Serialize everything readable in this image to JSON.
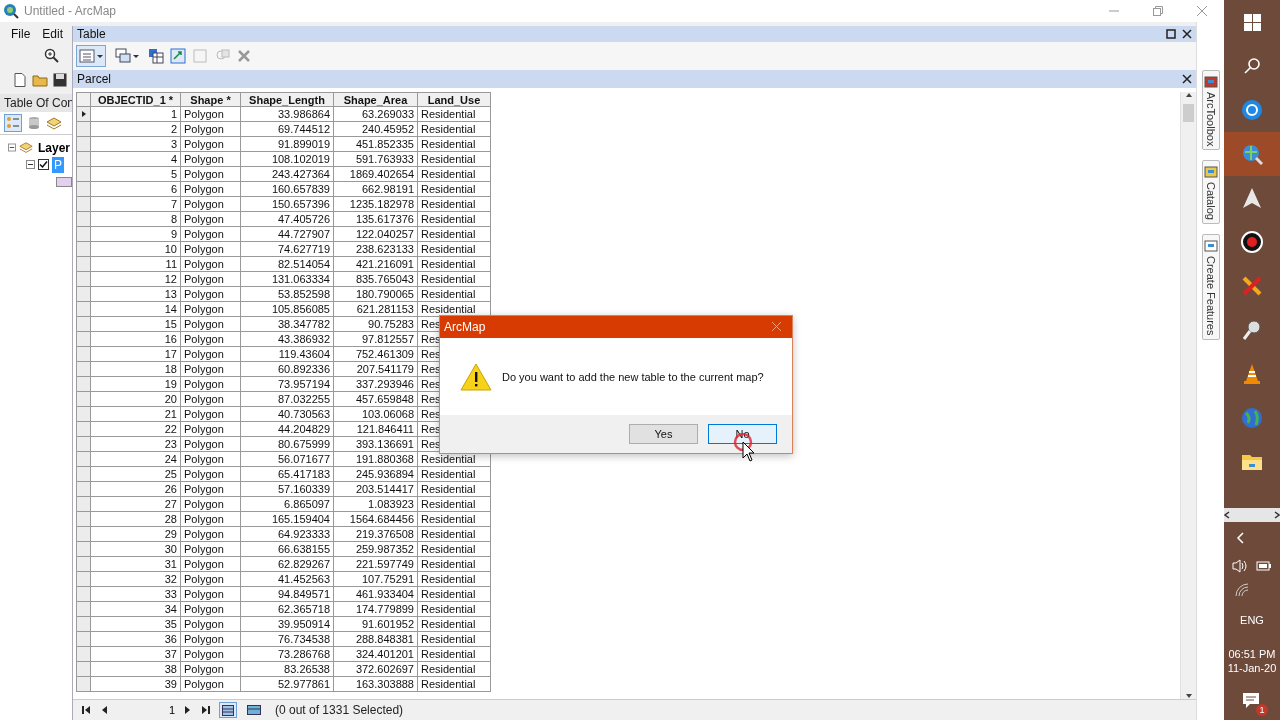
{
  "window": {
    "title": "Untitled - ArcMap"
  },
  "menu": [
    "File",
    "Edit"
  ],
  "toc": {
    "title": "Table Of Con",
    "layers": [
      {
        "label": "Layer",
        "expanded": true,
        "children": [
          {
            "label": "P",
            "expanded": true,
            "checked": true,
            "selected": true
          }
        ]
      }
    ]
  },
  "table_window": {
    "title": "Table",
    "tab": "Parcel",
    "columns": [
      "OBJECTID_1 *",
      "Shape *",
      "Shape_Length",
      "Shape_Area",
      "Land_Use"
    ],
    "rows": [
      {
        "current": true,
        "cells": [
          "1",
          "Polygon",
          "33.986864",
          "63.269033",
          "Residential"
        ]
      },
      {
        "current": false,
        "cells": [
          "2",
          "Polygon",
          "69.744512",
          "240.45952",
          "Residential"
        ]
      },
      {
        "current": false,
        "cells": [
          "3",
          "Polygon",
          "91.899019",
          "451.852335",
          "Residential"
        ]
      },
      {
        "current": false,
        "cells": [
          "4",
          "Polygon",
          "108.102019",
          "591.763933",
          "Residential"
        ]
      },
      {
        "current": false,
        "cells": [
          "5",
          "Polygon",
          "243.427364",
          "1869.402654",
          "Residential"
        ]
      },
      {
        "current": false,
        "cells": [
          "6",
          "Polygon",
          "160.657839",
          "662.98191",
          "Residential"
        ]
      },
      {
        "current": false,
        "cells": [
          "7",
          "Polygon",
          "150.657396",
          "1235.182978",
          "Residential"
        ]
      },
      {
        "current": false,
        "cells": [
          "8",
          "Polygon",
          "47.405726",
          "135.617376",
          "Residential"
        ]
      },
      {
        "current": false,
        "cells": [
          "9",
          "Polygon",
          "44.727907",
          "122.040257",
          "Residential"
        ]
      },
      {
        "current": false,
        "cells": [
          "10",
          "Polygon",
          "74.627719",
          "238.623133",
          "Residential"
        ]
      },
      {
        "current": false,
        "cells": [
          "11",
          "Polygon",
          "82.514054",
          "421.216091",
          "Residential"
        ]
      },
      {
        "current": false,
        "cells": [
          "12",
          "Polygon",
          "131.063334",
          "835.765043",
          "Residential"
        ]
      },
      {
        "current": false,
        "cells": [
          "13",
          "Polygon",
          "53.852598",
          "180.790065",
          "Residential"
        ]
      },
      {
        "current": false,
        "cells": [
          "14",
          "Polygon",
          "105.856085",
          "621.281153",
          "Residential"
        ]
      },
      {
        "current": false,
        "cells": [
          "15",
          "Polygon",
          "38.347782",
          "90.75283",
          "Res"
        ]
      },
      {
        "current": false,
        "cells": [
          "16",
          "Polygon",
          "43.386932",
          "97.812557",
          "Res"
        ]
      },
      {
        "current": false,
        "cells": [
          "17",
          "Polygon",
          "119.43604",
          "752.461309",
          "Res"
        ]
      },
      {
        "current": false,
        "cells": [
          "18",
          "Polygon",
          "60.892336",
          "207.541179",
          "Res"
        ]
      },
      {
        "current": false,
        "cells": [
          "19",
          "Polygon",
          "73.957194",
          "337.293946",
          "Res"
        ]
      },
      {
        "current": false,
        "cells": [
          "20",
          "Polygon",
          "87.032255",
          "457.659848",
          "Res"
        ]
      },
      {
        "current": false,
        "cells": [
          "21",
          "Polygon",
          "40.730563",
          "103.06068",
          "Res"
        ]
      },
      {
        "current": false,
        "cells": [
          "22",
          "Polygon",
          "44.204829",
          "121.846411",
          "Res"
        ]
      },
      {
        "current": false,
        "cells": [
          "23",
          "Polygon",
          "80.675999",
          "393.136691",
          "Res"
        ]
      },
      {
        "current": false,
        "cells": [
          "24",
          "Polygon",
          "56.071677",
          "191.880368",
          "Residential"
        ]
      },
      {
        "current": false,
        "cells": [
          "25",
          "Polygon",
          "65.417183",
          "245.936894",
          "Residential"
        ]
      },
      {
        "current": false,
        "cells": [
          "26",
          "Polygon",
          "57.160339",
          "203.514417",
          "Residential"
        ]
      },
      {
        "current": false,
        "cells": [
          "27",
          "Polygon",
          "6.865097",
          "1.083923",
          "Residential"
        ]
      },
      {
        "current": false,
        "cells": [
          "28",
          "Polygon",
          "165.159404",
          "1564.684456",
          "Residential"
        ]
      },
      {
        "current": false,
        "cells": [
          "29",
          "Polygon",
          "64.923333",
          "219.376508",
          "Residential"
        ]
      },
      {
        "current": false,
        "cells": [
          "30",
          "Polygon",
          "66.638155",
          "259.987352",
          "Residential"
        ]
      },
      {
        "current": false,
        "cells": [
          "31",
          "Polygon",
          "62.829267",
          "221.597749",
          "Residential"
        ]
      },
      {
        "current": false,
        "cells": [
          "32",
          "Polygon",
          "41.452563",
          "107.75291",
          "Residential"
        ]
      },
      {
        "current": false,
        "cells": [
          "33",
          "Polygon",
          "94.849571",
          "461.933404",
          "Residential"
        ]
      },
      {
        "current": false,
        "cells": [
          "34",
          "Polygon",
          "62.365718",
          "174.779899",
          "Residential"
        ]
      },
      {
        "current": false,
        "cells": [
          "35",
          "Polygon",
          "39.950914",
          "91.601952",
          "Residential"
        ]
      },
      {
        "current": false,
        "cells": [
          "36",
          "Polygon",
          "76.734538",
          "288.848381",
          "Residential"
        ]
      },
      {
        "current": false,
        "cells": [
          "37",
          "Polygon",
          "73.286768",
          "324.401201",
          "Residential"
        ]
      },
      {
        "current": false,
        "cells": [
          "38",
          "Polygon",
          "83.26538",
          "372.602697",
          "Residential"
        ]
      },
      {
        "current": false,
        "cells": [
          "39",
          "Polygon",
          "52.977861",
          "163.303888",
          "Residential"
        ]
      }
    ],
    "page": "1",
    "views": [
      {
        "selected": true
      },
      {
        "selected": false
      }
    ],
    "status": "(0 out of 1331 Selected)"
  },
  "dock_tabs": [
    "ArcToolbox",
    "Catalog",
    "Create Features"
  ],
  "dialog": {
    "title": "ArcMap",
    "message": "Do you want to add the new table to the current map?",
    "buttons": [
      {
        "label": "Yes",
        "focused": false
      },
      {
        "label": "No",
        "focused": true
      }
    ]
  },
  "taskbar": {
    "apps": [
      {
        "kind": "sync",
        "active": false
      },
      {
        "kind": "globe-search",
        "active": true
      },
      {
        "kind": "triangle",
        "active": false
      },
      {
        "kind": "record",
        "active": false
      },
      {
        "kind": "cross",
        "active": false
      },
      {
        "kind": "tool",
        "active": false
      },
      {
        "kind": "cone",
        "active": false
      },
      {
        "kind": "globe",
        "active": false
      },
      {
        "kind": "folder",
        "active": false
      }
    ],
    "language": "ENG",
    "time": "06:51 PM",
    "date": "11-Jan-20",
    "notifications": "1"
  }
}
